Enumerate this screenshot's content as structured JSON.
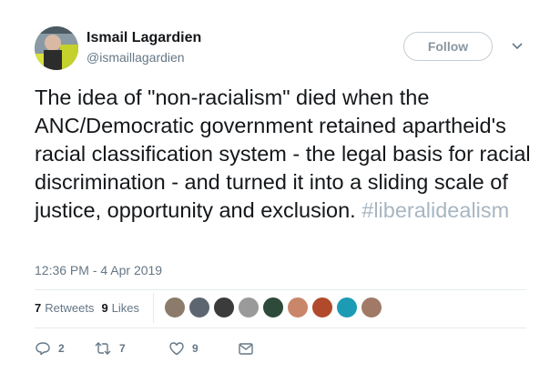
{
  "user": {
    "name": "Ismail Lagardien",
    "handle": "@ismaillagardien"
  },
  "follow_label": "Follow",
  "tweet": {
    "text": "The idea of \"non-racialism\" died when the ANC/Democratic government retained apartheid's racial classification system - the legal basis for racial discrimination - and turned it into a sliding scale of justice, opportunity and exclusion. ",
    "hashtag": "#liberalidealism",
    "timestamp": "12:36 PM - 4 Apr 2019"
  },
  "stats": {
    "retweets_count": "7",
    "retweets_label": "Retweets",
    "likes_count": "9",
    "likes_label": "Likes"
  },
  "liker_avatars": [
    {
      "name": "liker-avatar-1",
      "color": "#8c7b6a"
    },
    {
      "name": "liker-avatar-2",
      "color": "#5d6670"
    },
    {
      "name": "liker-avatar-3",
      "color": "#3b3b3b"
    },
    {
      "name": "liker-avatar-4",
      "color": "#9a9a9a"
    },
    {
      "name": "liker-avatar-5",
      "color": "#2e4a3a"
    },
    {
      "name": "liker-avatar-6",
      "color": "#c9866a"
    },
    {
      "name": "liker-avatar-7",
      "color": "#b04a2a"
    },
    {
      "name": "liker-avatar-8",
      "color": "#1d9bb5"
    },
    {
      "name": "liker-avatar-9",
      "color": "#a07a66"
    }
  ],
  "actions": {
    "reply_count": "2",
    "retweet_count": "7",
    "like_count": "9"
  },
  "icons": {
    "reply": "reply-icon",
    "retweet": "retweet-icon",
    "like": "heart-icon",
    "dm": "direct-message-icon",
    "caret": "chevron-down-icon"
  },
  "colors": {
    "hashtag": "#a7b6c2",
    "secondary_text": "#657786",
    "divider": "#e6ecf0"
  }
}
